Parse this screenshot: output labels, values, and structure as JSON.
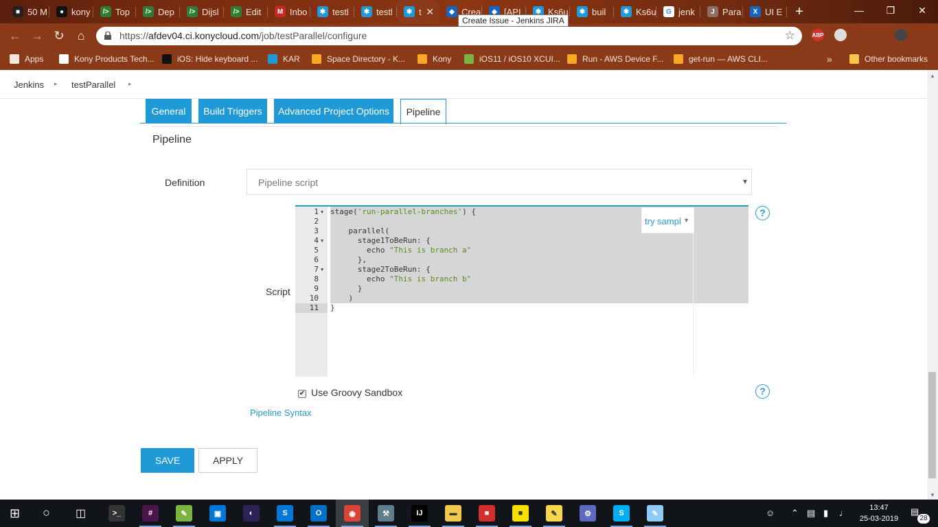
{
  "browser": {
    "tabs": [
      {
        "label": "50 M",
        "color": "#222222",
        "glyph": "■"
      },
      {
        "label": "kony",
        "color": "#111111",
        "glyph": "●"
      },
      {
        "label": "Top",
        "color": "#2e7d32",
        "glyph": "/>"
      },
      {
        "label": "Dep",
        "color": "#2e7d32",
        "glyph": "/>"
      },
      {
        "label": "Dijsl",
        "color": "#2e7d32",
        "glyph": "/>"
      },
      {
        "label": "Edit",
        "color": "#2e7d32",
        "glyph": "/>"
      },
      {
        "label": "Inbo",
        "color": "#c62828",
        "glyph": "M"
      },
      {
        "label": "testl",
        "color": "#1f9ad7",
        "glyph": "✱"
      },
      {
        "label": "testl",
        "color": "#1f9ad7",
        "glyph": "✱"
      },
      {
        "label": "t",
        "color": "#1f9ad7",
        "glyph": "✱",
        "active": true
      },
      {
        "label": "Crea",
        "color": "#1565c0",
        "glyph": "◆"
      },
      {
        "label": "[API",
        "color": "#1565c0",
        "glyph": "◆"
      },
      {
        "label": "Ks6u",
        "color": "#1f9ad7",
        "glyph": "✱"
      },
      {
        "label": "buil",
        "color": "#1f9ad7",
        "glyph": "✱"
      },
      {
        "label": "Ks6u",
        "color": "#1f9ad7",
        "glyph": "✱"
      },
      {
        "label": "jenk",
        "color": "#ffffff",
        "glyph": "G"
      },
      {
        "label": "Para",
        "color": "#8d6e63",
        "glyph": "J"
      },
      {
        "label": "UI E",
        "color": "#1565c0",
        "glyph": "X"
      }
    ],
    "active_tab_close": "✕",
    "new_tab": "+",
    "tooltip": "Create Issue - Jenkins JIRA",
    "window_buttons": [
      "—",
      "❐",
      "✕"
    ],
    "url_prefix": "https://",
    "url_host": "afdev04.ci.konycloud.com",
    "url_path": "/job/testParallel/configure",
    "extensions": [
      {
        "name": "adblock-icon",
        "label": "ABP",
        "color": "#d32f2f"
      },
      {
        "name": "extension-circle-icon",
        "label": "",
        "color": "#dddddd"
      },
      {
        "name": "profile-avatar-icon",
        "label": "",
        "color": "#444444"
      }
    ],
    "bookmarks": [
      {
        "label": "Apps",
        "icon": "apps-grid-icon",
        "color": "#f3e6dc"
      },
      {
        "label": "Kony Products Tech...",
        "icon": "page-icon",
        "color": "#ffffff"
      },
      {
        "label": "iOS: Hide keyboard ...",
        "icon": "github-icon",
        "color": "#111111"
      },
      {
        "label": "KAR",
        "icon": "kony-icon",
        "color": "#1f9ad7"
      },
      {
        "label": "Space Directory - K...",
        "icon": "confluence-icon",
        "color": "#f9a825"
      },
      {
        "label": "Kony",
        "icon": "kony-icon",
        "color": "#f9a825"
      },
      {
        "label": "iOS11 / iOS10 XCUI...",
        "icon": "stackoverflow-icon",
        "color": "#7cb342"
      },
      {
        "label": "Run - AWS Device F...",
        "icon": "aws-icon",
        "color": "#f9a825"
      },
      {
        "label": "get-run — AWS CLI...",
        "icon": "aws-icon",
        "color": "#f9a825"
      }
    ],
    "bookmarks_overflow": "»",
    "other_bookmarks": "Other bookmarks"
  },
  "jenkins": {
    "breadcrumb": [
      "Jenkins",
      "testParallel"
    ],
    "tabs": [
      "General",
      "Build Triggers",
      "Advanced Project Options",
      "Pipeline"
    ],
    "active_tab": "Pipeline",
    "section_title": "Pipeline",
    "definition_label": "Definition",
    "definition_value": "Pipeline script",
    "script_label": "Script",
    "try_sample": "try sampl",
    "script_lines": [
      {
        "n": "1",
        "fold": true,
        "text": "stage(",
        "str": "'run-parallel-branches'",
        "tail": ") {"
      },
      {
        "n": "2",
        "fold": false,
        "text": "",
        "str": "",
        "tail": ""
      },
      {
        "n": "3",
        "fold": false,
        "text": "    parallel(",
        "str": "",
        "tail": ""
      },
      {
        "n": "4",
        "fold": true,
        "text": "      stage1ToBeRun: {",
        "str": "",
        "tail": ""
      },
      {
        "n": "5",
        "fold": false,
        "text": "        echo ",
        "str": "\"This is branch a\"",
        "tail": ""
      },
      {
        "n": "6",
        "fold": false,
        "text": "      },",
        "str": "",
        "tail": ""
      },
      {
        "n": "7",
        "fold": true,
        "text": "      stage2ToBeRun: {",
        "str": "",
        "tail": ""
      },
      {
        "n": "8",
        "fold": false,
        "text": "        echo ",
        "str": "\"This is branch b\"",
        "tail": ""
      },
      {
        "n": "9",
        "fold": false,
        "text": "      }",
        "str": "",
        "tail": ""
      },
      {
        "n": "10",
        "fold": false,
        "text": "    )",
        "str": "",
        "tail": ""
      },
      {
        "n": "11",
        "fold": false,
        "text": "}",
        "str": "",
        "tail": ""
      }
    ],
    "help": "?",
    "sandbox_label": "Use Groovy Sandbox",
    "sandbox_checked": true,
    "checkmark": "✔",
    "pipeline_syntax_link": "Pipeline Syntax",
    "save_label": "SAVE",
    "apply_label": "APPLY"
  },
  "taskbar": {
    "time": "13:47",
    "date": "25-03-2019",
    "notification_count": "28",
    "apps": [
      {
        "name": "taskbar-cmd-icon",
        "color": "#333333",
        "glyph": ">_"
      },
      {
        "name": "taskbar-slack-icon",
        "color": "#4a154b",
        "glyph": "#"
      },
      {
        "name": "taskbar-notes-icon",
        "color": "#7cb342",
        "glyph": "✎"
      },
      {
        "name": "taskbar-store-icon",
        "color": "#0078d7",
        "glyph": "▣"
      },
      {
        "name": "taskbar-eclipse-icon",
        "color": "#2c2255",
        "glyph": "◐"
      },
      {
        "name": "taskbar-skype-business-icon",
        "color": "#0078d7",
        "glyph": "S"
      },
      {
        "name": "taskbar-outlook-icon",
        "color": "#0072c6",
        "glyph": "O"
      },
      {
        "name": "taskbar-chrome-icon",
        "color": "#db4437",
        "glyph": "◉",
        "active": true
      },
      {
        "name": "taskbar-xcode-icon",
        "color": "#607d8b",
        "glyph": "⚒"
      },
      {
        "name": "taskbar-intellij-icon",
        "color": "#000000",
        "glyph": "IJ"
      },
      {
        "name": "taskbar-explorer-icon",
        "color": "#f2c94c",
        "glyph": "▬"
      },
      {
        "name": "taskbar-app-icon",
        "color": "#d32f2f",
        "glyph": "■"
      },
      {
        "name": "taskbar-stickynotes-icon",
        "color": "#f9e000",
        "glyph": "■"
      },
      {
        "name": "taskbar-notepad-icon",
        "color": "#f9d74c",
        "glyph": "✎"
      },
      {
        "name": "taskbar-app2-icon",
        "color": "#5c6bc0",
        "glyph": "⚙"
      },
      {
        "name": "taskbar-skype-icon",
        "color": "#00aff0",
        "glyph": "S"
      },
      {
        "name": "taskbar-paint-icon",
        "color": "#90caf9",
        "glyph": "✎"
      }
    ]
  }
}
